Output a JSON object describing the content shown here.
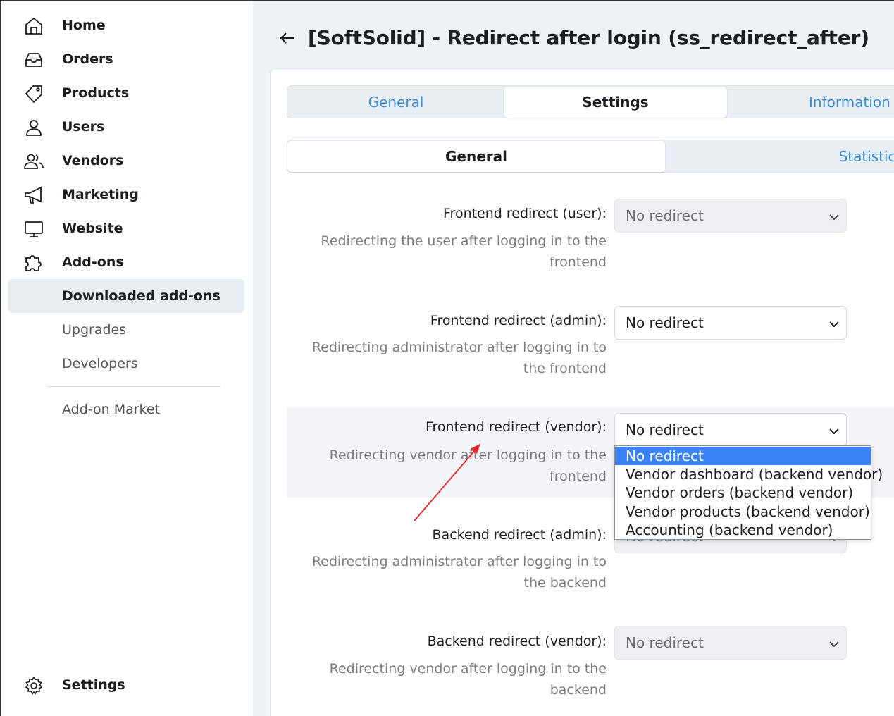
{
  "sidebar": {
    "items": [
      {
        "label": "Home",
        "icon": "home-icon"
      },
      {
        "label": "Orders",
        "icon": "inbox-icon"
      },
      {
        "label": "Products",
        "icon": "tag-icon"
      },
      {
        "label": "Users",
        "icon": "user-icon"
      },
      {
        "label": "Vendors",
        "icon": "users-icon"
      },
      {
        "label": "Marketing",
        "icon": "megaphone-icon"
      },
      {
        "label": "Website",
        "icon": "monitor-icon"
      },
      {
        "label": "Add-ons",
        "icon": "puzzle-icon"
      }
    ],
    "subitems": [
      {
        "label": "Downloaded add-ons",
        "active": true
      },
      {
        "label": "Upgrades"
      },
      {
        "label": "Developers"
      }
    ],
    "market_label": "Add-on Market",
    "settings_label": "Settings"
  },
  "header": {
    "title": "[SoftSolid] - Redirect after login (ss_redirect_after)"
  },
  "tabs": [
    {
      "label": "General"
    },
    {
      "label": "Settings",
      "active": true
    },
    {
      "label": "Information"
    }
  ],
  "subtabs": [
    {
      "label": "General",
      "active": true
    },
    {
      "label": "Statistics"
    }
  ],
  "settings": [
    {
      "label": "Frontend redirect (user):",
      "desc": "Redirecting the user after logging in to the frontend",
      "value": "No redirect",
      "disabled": true
    },
    {
      "label": "Frontend redirect (admin):",
      "desc": "Redirecting administrator after logging in to the frontend",
      "value": "No redirect",
      "disabled": false
    },
    {
      "label": "Frontend redirect (vendor):",
      "desc": "Redirecting vendor after logging in to the frontend",
      "value": "No redirect",
      "disabled": false
    },
    {
      "label": "Backend redirect (admin):",
      "desc": "Redirecting administrator after logging in to the backend",
      "value": "No redirect",
      "disabled": true
    },
    {
      "label": "Backend redirect (vendor):",
      "desc": "Redirecting vendor after logging in to the backend",
      "value": "No redirect",
      "disabled": true
    }
  ],
  "dropdown": {
    "options": [
      "No redirect",
      "Vendor dashboard (backend vendor)",
      "Vendor orders (backend vendor)",
      "Vendor products (backend vendor)",
      "Accounting (backend vendor)"
    ],
    "selected": "No redirect"
  },
  "colors": {
    "accent": "#3a8fd6",
    "selection": "#3b82f6",
    "annotation": "#e8262b"
  }
}
